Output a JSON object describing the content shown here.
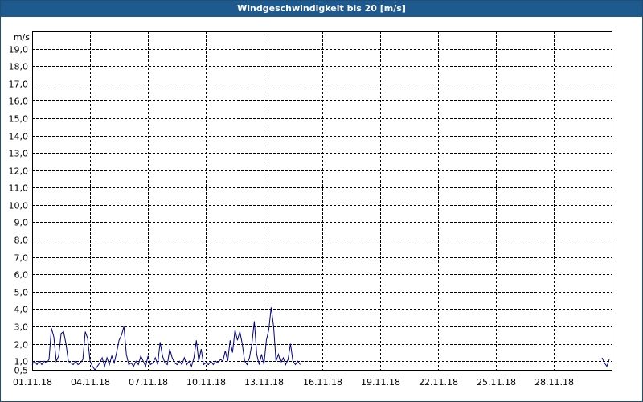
{
  "window": {
    "title": "Windgeschwindigkeit bis 20 [m/s]"
  },
  "colors": {
    "titlebar": "#1f5a8f",
    "series": "#00008b",
    "grid": "#000000"
  },
  "chart_data": {
    "type": "line",
    "title": "Windgeschwindigkeit bis 20 [m/s]",
    "ylabel": "m/s",
    "xlabel": "",
    "ylim": [
      0.5,
      20.0
    ],
    "y_ticks": [
      "0,5",
      "1,0",
      "2,0",
      "3,0",
      "4,0",
      "5,0",
      "6,0",
      "7,0",
      "8,0",
      "9,0",
      "10,0",
      "11,0",
      "12,0",
      "13,0",
      "14,0",
      "15,0",
      "16,0",
      "17,0",
      "18,0",
      "19,0"
    ],
    "xlim": [
      "2018-11-01",
      "2018-12-01"
    ],
    "x_ticks": [
      "01.11.18",
      "04.11.18",
      "07.11.18",
      "10.11.18",
      "13.11.18",
      "16.11.18",
      "19.11.18",
      "22.11.18",
      "25.11.18",
      "28.11.18"
    ],
    "grid": true,
    "series": [
      {
        "color": "#00008b",
        "points": [
          [
            "2018-11-01 00:00",
            0.8
          ],
          [
            "2018-11-01 03:00",
            1.0
          ],
          [
            "2018-11-01 06:00",
            0.8
          ],
          [
            "2018-11-01 09:00",
            1.0
          ],
          [
            "2018-11-01 12:00",
            0.8
          ],
          [
            "2018-11-01 15:00",
            1.0
          ],
          [
            "2018-11-01 18:00",
            0.9
          ],
          [
            "2018-11-01 21:00",
            1.1
          ],
          [
            "2018-11-02 00:00",
            2.9
          ],
          [
            "2018-11-02 03:00",
            2.4
          ],
          [
            "2018-11-02 06:00",
            1.0
          ],
          [
            "2018-11-02 09:00",
            1.3
          ],
          [
            "2018-11-02 12:00",
            2.6
          ],
          [
            "2018-11-02 15:00",
            2.7
          ],
          [
            "2018-11-02 18:00",
            2.0
          ],
          [
            "2018-11-02 21:00",
            1.0
          ],
          [
            "2018-11-03 00:00",
            0.9
          ],
          [
            "2018-11-03 03:00",
            0.8
          ],
          [
            "2018-11-03 06:00",
            1.0
          ],
          [
            "2018-11-03 09:00",
            0.8
          ],
          [
            "2018-11-03 12:00",
            0.9
          ],
          [
            "2018-11-03 15:00",
            1.1
          ],
          [
            "2018-11-03 18:00",
            2.7
          ],
          [
            "2018-11-03 21:00",
            2.3
          ],
          [
            "2018-11-04 00:00",
            1.0
          ],
          [
            "2018-11-04 03:00",
            0.7
          ],
          [
            "2018-11-04 06:00",
            0.5
          ],
          [
            "2018-11-04 09:00",
            0.7
          ],
          [
            "2018-11-04 12:00",
            0.9
          ],
          [
            "2018-11-04 15:00",
            1.2
          ],
          [
            "2018-11-04 18:00",
            0.7
          ],
          [
            "2018-11-04 21:00",
            1.2
          ],
          [
            "2018-11-05 00:00",
            0.8
          ],
          [
            "2018-11-05 03:00",
            1.3
          ],
          [
            "2018-11-05 06:00",
            0.9
          ],
          [
            "2018-11-05 09:00",
            1.5
          ],
          [
            "2018-11-05 12:00",
            2.2
          ],
          [
            "2018-11-05 15:00",
            2.5
          ],
          [
            "2018-11-05 18:00",
            3.0
          ],
          [
            "2018-11-05 21:00",
            1.4
          ],
          [
            "2018-11-06 00:00",
            0.8
          ],
          [
            "2018-11-06 03:00",
            0.9
          ],
          [
            "2018-11-06 06:00",
            0.7
          ],
          [
            "2018-11-06 09:00",
            1.0
          ],
          [
            "2018-11-06 12:00",
            0.8
          ],
          [
            "2018-11-06 15:00",
            1.3
          ],
          [
            "2018-11-06 18:00",
            1.0
          ],
          [
            "2018-11-06 21:00",
            0.7
          ],
          [
            "2018-11-07 00:00",
            1.3
          ],
          [
            "2018-11-07 03:00",
            0.8
          ],
          [
            "2018-11-07 06:00",
            0.9
          ],
          [
            "2018-11-07 09:00",
            1.2
          ],
          [
            "2018-11-07 12:00",
            0.8
          ],
          [
            "2018-11-07 15:00",
            2.1
          ],
          [
            "2018-11-07 18:00",
            1.3
          ],
          [
            "2018-11-07 21:00",
            0.9
          ],
          [
            "2018-11-08 00:00",
            0.8
          ],
          [
            "2018-11-08 03:00",
            1.7
          ],
          [
            "2018-11-08 06:00",
            1.2
          ],
          [
            "2018-11-08 09:00",
            0.9
          ],
          [
            "2018-11-08 12:00",
            0.8
          ],
          [
            "2018-11-08 15:00",
            1.0
          ],
          [
            "2018-11-08 18:00",
            0.8
          ],
          [
            "2018-11-08 21:00",
            1.2
          ],
          [
            "2018-11-09 00:00",
            0.8
          ],
          [
            "2018-11-09 03:00",
            1.0
          ],
          [
            "2018-11-09 06:00",
            0.7
          ],
          [
            "2018-11-09 09:00",
            1.2
          ],
          [
            "2018-11-09 12:00",
            2.2
          ],
          [
            "2018-11-09 15:00",
            1.0
          ],
          [
            "2018-11-09 18:00",
            1.7
          ],
          [
            "2018-11-09 21:00",
            0.8
          ],
          [
            "2018-11-10 00:00",
            0.9
          ],
          [
            "2018-11-10 03:00",
            0.8
          ],
          [
            "2018-11-10 06:00",
            1.0
          ],
          [
            "2018-11-10 09:00",
            0.8
          ],
          [
            "2018-11-10 12:00",
            1.0
          ],
          [
            "2018-11-10 15:00",
            0.9
          ],
          [
            "2018-11-10 18:00",
            1.1
          ],
          [
            "2018-11-10 21:00",
            1.0
          ],
          [
            "2018-11-11 00:00",
            1.6
          ],
          [
            "2018-11-11 03:00",
            1.0
          ],
          [
            "2018-11-11 06:00",
            2.2
          ],
          [
            "2018-11-11 09:00",
            1.5
          ],
          [
            "2018-11-11 12:00",
            2.8
          ],
          [
            "2018-11-11 15:00",
            2.2
          ],
          [
            "2018-11-11 18:00",
            2.7
          ],
          [
            "2018-11-11 21:00",
            2.0
          ],
          [
            "2018-11-12 00:00",
            1.0
          ],
          [
            "2018-11-12 03:00",
            0.8
          ],
          [
            "2018-11-12 06:00",
            1.2
          ],
          [
            "2018-11-12 09:00",
            2.0
          ],
          [
            "2018-11-12 12:00",
            3.3
          ],
          [
            "2018-11-12 15:00",
            1.4
          ],
          [
            "2018-11-12 18:00",
            0.8
          ],
          [
            "2018-11-12 21:00",
            1.4
          ],
          [
            "2018-11-13 00:00",
            0.8
          ],
          [
            "2018-11-13 03:00",
            2.2
          ],
          [
            "2018-11-13 06:00",
            2.8
          ],
          [
            "2018-11-13 09:00",
            4.1
          ],
          [
            "2018-11-13 12:00",
            3.0
          ],
          [
            "2018-11-13 15:00",
            1.0
          ],
          [
            "2018-11-13 18:00",
            1.4
          ],
          [
            "2018-11-13 21:00",
            0.9
          ],
          [
            "2018-11-14 00:00",
            1.2
          ],
          [
            "2018-11-14 03:00",
            0.8
          ],
          [
            "2018-11-14 06:00",
            1.1
          ],
          [
            "2018-11-14 09:00",
            2.0
          ],
          [
            "2018-11-14 12:00",
            1.0
          ],
          [
            "2018-11-14 15:00",
            0.8
          ],
          [
            "2018-11-14 18:00",
            1.0
          ],
          [
            "2018-11-14 21:00",
            0.8
          ]
        ]
      },
      {
        "color": "#00008b",
        "points": [
          [
            "2018-11-30 12:00",
            1.2
          ],
          [
            "2018-11-30 15:00",
            0.9
          ],
          [
            "2018-11-30 18:00",
            0.7
          ],
          [
            "2018-11-30 21:00",
            1.1
          ]
        ]
      }
    ]
  }
}
